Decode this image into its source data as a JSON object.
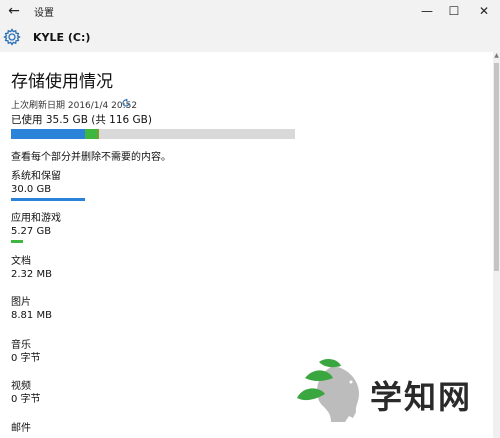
{
  "window": {
    "title": "设置",
    "back_glyph": "←",
    "minimize_glyph": "—",
    "maximize_glyph": "☐",
    "close_glyph": "✕"
  },
  "header": {
    "drive_label": "KYLE (C:)"
  },
  "storage": {
    "page_title": "存储使用情况",
    "last_refresh": "上次刷新日期 2016/1/4 20:52",
    "used_summary": "已使用 35.5 GB (共 116 GB)",
    "usage_fraction": 0.306,
    "segment_colors": {
      "system": "#2b82d9",
      "apps": "#3fb63f",
      "documents": "#7a9f2c",
      "free": "#d9d9d9"
    },
    "hint": "查看每个部分并删除不需要的内容。",
    "categories": [
      {
        "name": "系统和保留",
        "size": "30.0 GB",
        "color": "#2b82d9"
      },
      {
        "name": "应用和游戏",
        "size": "5.27 GB",
        "color": "#3fb63f"
      },
      {
        "name": "文档",
        "size": "2.32 MB"
      },
      {
        "name": "图片",
        "size": "8.81 MB"
      },
      {
        "name": "音乐",
        "size": "0 字节"
      },
      {
        "name": "视频",
        "size": "0 字节"
      },
      {
        "name": "邮件",
        "size": ""
      }
    ]
  },
  "icons": {
    "gear": "gear-icon",
    "refresh": "refresh-icon",
    "back": "back-arrow-icon"
  },
  "watermark": {
    "text": "学知网"
  }
}
